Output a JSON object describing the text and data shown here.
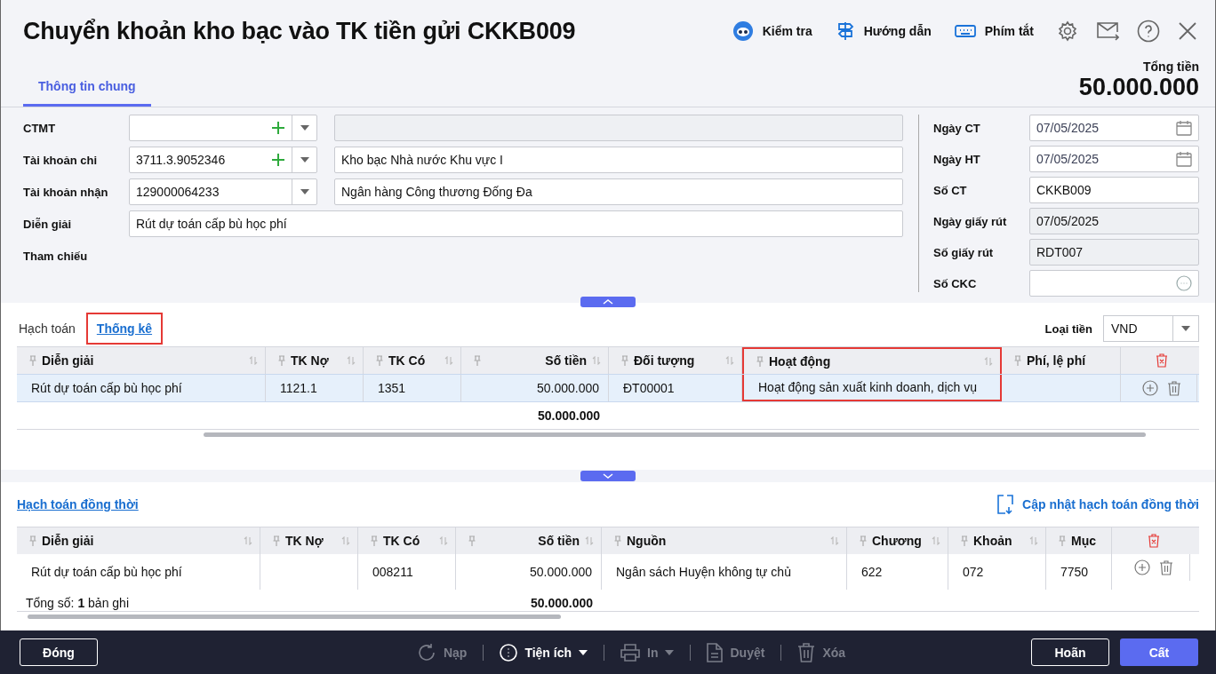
{
  "window": {
    "title": "Chuyển khoản kho bạc vào TK tiền gửi CKKB009"
  },
  "toolbar": [
    {
      "kind": "check",
      "label": "Kiểm tra"
    },
    {
      "kind": "guide",
      "label": "Hướng dẫn"
    },
    {
      "kind": "shortcut",
      "label": "Phím tắt"
    }
  ],
  "total": {
    "label": "Tổng tiền",
    "value": "50.000.000"
  },
  "tabs": [
    {
      "label": "Thông tin chung",
      "selected": true
    }
  ],
  "form_left": [
    {
      "label": "CTMT",
      "add": true,
      "dropdown": true,
      "name_disabled": true
    },
    {
      "label": "Tài khoản chi",
      "code": "3711.3.9052346",
      "add": true,
      "dropdown": true,
      "name": "Kho bạc Nhà nước Khu vực I",
      "name_disabled": false
    },
    {
      "label": "Tài khoản nhận",
      "code": "129000064233",
      "add": false,
      "dropdown": true,
      "name": "Ngân hàng Công thương Đống Đa",
      "name_disabled": false
    },
    {
      "label": "Diễn giải",
      "kind": "wide",
      "value": "Rút dự toán cấp bù học phí"
    },
    {
      "label": "Tham chiếu",
      "kind": "none"
    }
  ],
  "form_right": [
    {
      "label": "Ngày CT",
      "value": "07/05/2025",
      "kind": "date",
      "disabled": false
    },
    {
      "label": "Ngày HT",
      "value": "07/05/2025",
      "kind": "date",
      "disabled": false
    },
    {
      "label": "Số CT",
      "value": "CKKB009",
      "kind": "text",
      "disabled": false
    },
    {
      "label": "Ngày giấy rút",
      "value": "07/05/2025",
      "kind": "text",
      "disabled": true
    },
    {
      "label": "Số giấy rút",
      "value": "RDT007",
      "kind": "text",
      "disabled": true
    },
    {
      "label": "Số CKC",
      "kind": "lookup",
      "disabled": false
    }
  ],
  "detail_tabs": [
    {
      "label": "Hạch toán",
      "selected": false,
      "highlighted": false
    },
    {
      "label": "Thống kê",
      "selected": true,
      "highlighted": true
    }
  ],
  "currency": {
    "label": "Loại tiền",
    "value": "VND"
  },
  "table": {
    "columns": [
      {
        "label": "Diễn giải",
        "kind": "text",
        "highlighted": false
      },
      {
        "label": "TK Nợ",
        "kind": "text",
        "highlighted": false
      },
      {
        "label": "TK Có",
        "kind": "text",
        "highlighted": false
      },
      {
        "label": "Số tiền",
        "kind": "amount",
        "highlighted": false
      },
      {
        "label": "Đối tượng",
        "kind": "text",
        "highlighted": false
      },
      {
        "label": "Hoạt động",
        "kind": "text",
        "highlighted": true
      },
      {
        "label": "Phí, lệ phí",
        "kind": "text",
        "highlighted": false
      }
    ],
    "rows": [
      {
        "selected": true,
        "cells": [
          "Rút dự toán cấp bù học phí",
          "1121.1",
          "1351",
          "50.000.000",
          "ĐT00001",
          "Hoạt động sản xuất kinh doanh, dịch vụ",
          ""
        ]
      }
    ],
    "total": "50.000.000"
  },
  "concurrent": {
    "title": "Hạch toán đồng thời",
    "update": "Cập nhật hạch toán đồng thời",
    "columns": [
      {
        "label": "Diễn giải",
        "kind": "text"
      },
      {
        "label": "TK Nợ",
        "kind": "text"
      },
      {
        "label": "TK Có",
        "kind": "text"
      },
      {
        "label": "Số tiền",
        "kind": "amount"
      },
      {
        "label": "Nguồn",
        "kind": "text"
      },
      {
        "label": "Chương",
        "kind": "text"
      },
      {
        "label": "Khoản",
        "kind": "text"
      },
      {
        "label": "Mục",
        "kind": "text"
      }
    ],
    "rows": [
      {
        "selected": false,
        "cells": [
          "Rút dự toán cấp bù học phí",
          "",
          "008211",
          "50.000.000",
          "Ngân sách Huyện không tự chủ",
          "622",
          "072",
          "7750"
        ]
      }
    ],
    "count": "Tổng số: **1** bản ghi",
    "total": "50.000.000"
  },
  "footer": [
    {
      "kind": "close",
      "label": "Đóng",
      "disabled": false
    },
    {
      "kind": "reload",
      "label": "Nạp",
      "disabled": true
    },
    {
      "kind": "utility",
      "label": "Tiện ích",
      "disabled": false
    },
    {
      "kind": "print",
      "label": "In",
      "disabled": true
    },
    {
      "kind": "approve",
      "label": "Duyệt",
      "disabled": true
    },
    {
      "kind": "delete",
      "label": "Xóa",
      "disabled": true
    },
    {
      "kind": "cancel",
      "label": "Hoãn",
      "disabled": false
    },
    {
      "kind": "save",
      "label": "Cất",
      "disabled": false
    }
  ]
}
